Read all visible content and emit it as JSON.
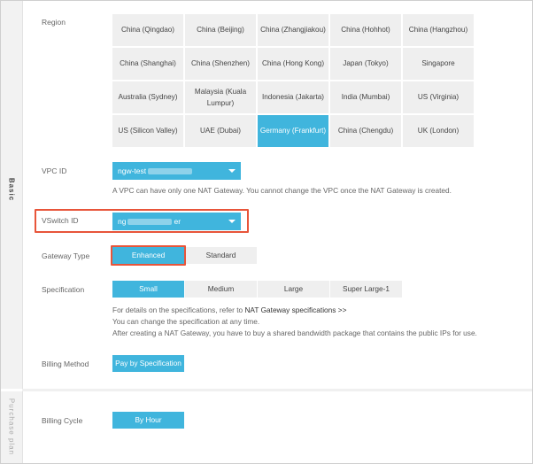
{
  "sections": {
    "basic": "Basic",
    "purchase": "Purchase plan"
  },
  "region": {
    "label": "Region",
    "cells": [
      {
        "name": "China (Qingdao)",
        "selected": false
      },
      {
        "name": "China (Beijing)",
        "selected": false
      },
      {
        "name": "China (Zhangjiakou)",
        "selected": false
      },
      {
        "name": "China (Hohhot)",
        "selected": false
      },
      {
        "name": "China (Hangzhou)",
        "selected": false
      },
      {
        "name": "China (Shanghai)",
        "selected": false
      },
      {
        "name": "China (Shenzhen)",
        "selected": false
      },
      {
        "name": "China (Hong Kong)",
        "selected": false
      },
      {
        "name": "Japan (Tokyo)",
        "selected": false
      },
      {
        "name": "Singapore",
        "selected": false
      },
      {
        "name": "Australia (Sydney)",
        "selected": false
      },
      {
        "name": "Malaysia (Kuala Lumpur)",
        "selected": false
      },
      {
        "name": "Indonesia (Jakarta)",
        "selected": false
      },
      {
        "name": "India (Mumbai)",
        "selected": false
      },
      {
        "name": "US (Virginia)",
        "selected": false
      },
      {
        "name": "US (Silicon Valley)",
        "selected": false
      },
      {
        "name": "UAE (Dubai)",
        "selected": false
      },
      {
        "name": "Germany (Frankfurt)",
        "selected": true
      },
      {
        "name": "China (Chengdu)",
        "selected": false
      },
      {
        "name": "UK (London)",
        "selected": false
      }
    ]
  },
  "vpc": {
    "label": "VPC ID",
    "value": "ngw-test",
    "hint": "A VPC can have only one NAT Gateway. You cannot change the VPC once the NAT Gateway is created."
  },
  "vswitch": {
    "label": "VSwitch ID",
    "value_prefix": "ng",
    "value_suffix": "er"
  },
  "gateway_type": {
    "label": "Gateway Type",
    "options": [
      "Enhanced",
      "Standard"
    ],
    "selected": "Enhanced"
  },
  "specification": {
    "label": "Specification",
    "options": [
      "Small",
      "Medium",
      "Large",
      "Super Large-1"
    ],
    "selected": "Small",
    "hint_prefix": "For details on the specifications, refer to",
    "hint_link": "NAT Gateway specifications >>",
    "hint_line2": "You can change the specification at any time.",
    "hint_line3": "After creating a NAT Gateway, you have to buy a shared bandwidth package that contains the public IPs for use."
  },
  "billing_method": {
    "label": "Billing Method",
    "value": "Pay by Specification"
  },
  "billing_cycle": {
    "label": "Billing Cycle",
    "value": "By Hour"
  },
  "colors": {
    "accent": "#40b5dd",
    "highlight": "#e8553a",
    "inactive": "#efefef"
  }
}
